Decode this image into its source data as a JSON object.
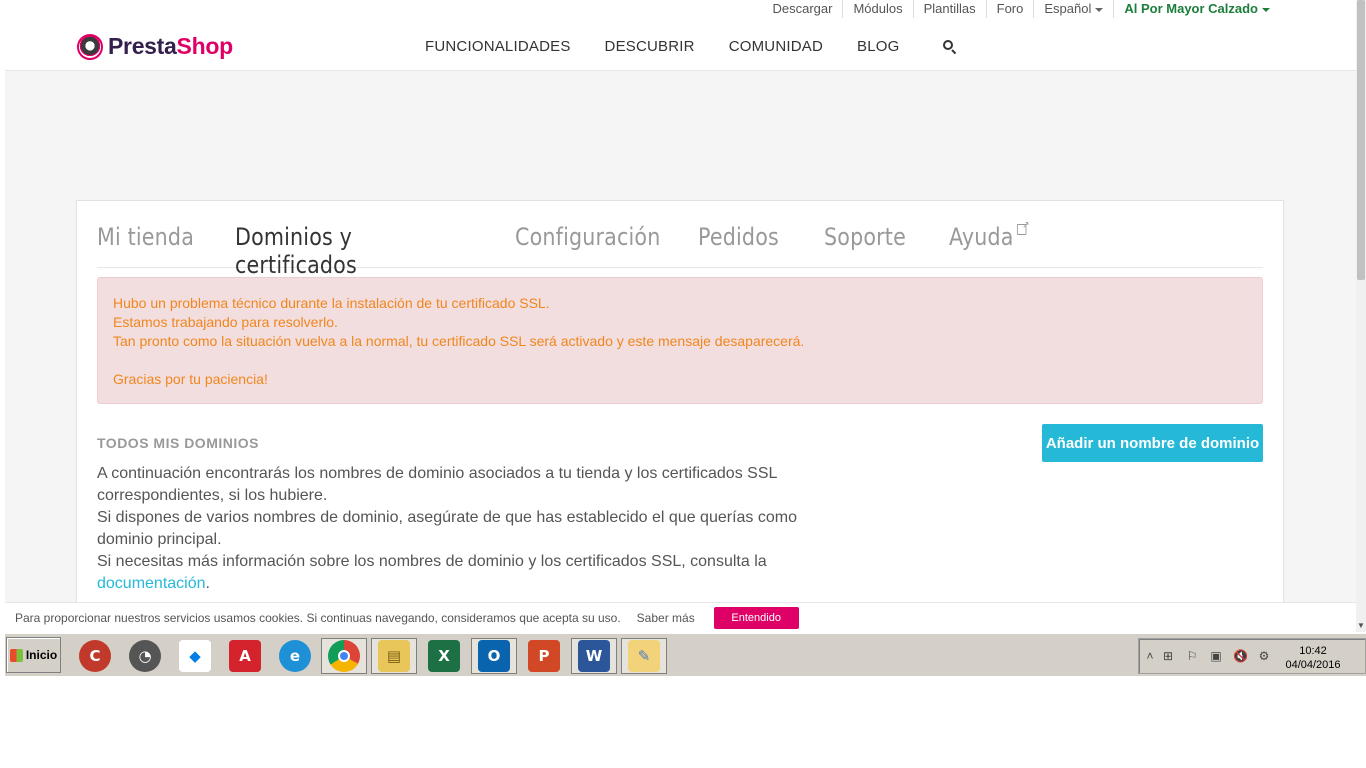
{
  "topbar": {
    "links": [
      "Descargar",
      "Módulos",
      "Plantillas",
      "Foro"
    ],
    "language": "Español",
    "store": "Al Por Mayor Calzado"
  },
  "brand": {
    "name_1": "Presta",
    "name_2": "Shop"
  },
  "nav": [
    "FUNCIONALIDADES",
    "DESCUBRIR",
    "COMUNIDAD",
    "BLOG"
  ],
  "tabs": {
    "mi_tienda": "Mi tienda",
    "dominios": "Dominios y certificados",
    "configuracion": "Configuración",
    "pedidos": "Pedidos",
    "soporte": "Soporte",
    "ayuda": "Ayuda"
  },
  "alert": {
    "line1": "Hubo un problema técnico durante la instalación de tu certificado SSL.",
    "line2": "Estamos trabajando para resolverlo.",
    "line3": "Tan pronto como la situación vuelva a la normal, tu certificado SSL será activado y este mensaje desaparecerá.",
    "line4": "Gracias por tu paciencia!"
  },
  "domains": {
    "title": "TODOS MIS DOMINIOS",
    "add_button": "Añadir un nombre de dominio",
    "p1": "A continuación encontrarás los nombres de dominio asociados a tu tienda y los certificados SSL correspondientes, si los hubiere.",
    "p2": "Si dispones de varios nombres de dominio, asegúrate de que has establecido el que querías como dominio principal.",
    "p3": "Si necesitas más información sobre los nombres de dominio y los certificados SSL, consulta la",
    "link": "documentación",
    "p3_end": "."
  },
  "cookie": {
    "text": "Para proporcionar nuestros servicios usamos cookies. Si continuas navegando, consideramos que acepta su uso.",
    "more": "Saber más",
    "ok": "Entendido"
  },
  "taskbar": {
    "start": "Inicio",
    "apps": [
      "ccleaner-icon",
      "app-icon",
      "dropbox-icon",
      "acrobat-icon",
      "internet-explorer-icon",
      "chrome-icon",
      "file-explorer-icon",
      "excel-icon",
      "outlook-icon",
      "powerpoint-icon",
      "word-icon",
      "paint-icon"
    ],
    "time": "10:42",
    "date": "04/04/2016"
  },
  "colors": {
    "brand_pink": "#df0067",
    "accent_blue": "#25b9d7",
    "alert_text": "#f0861f",
    "store_green": "#1b7e3b"
  }
}
